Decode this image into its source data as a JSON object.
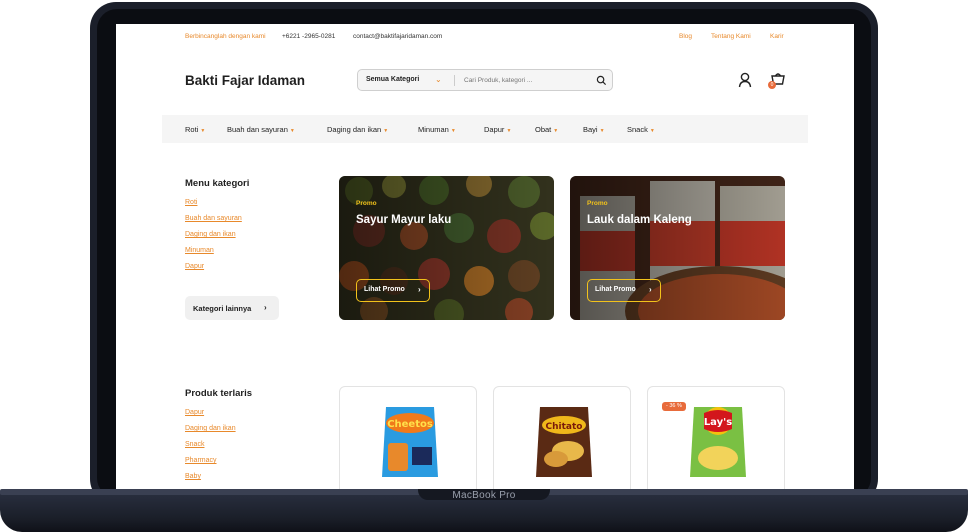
{
  "device": {
    "label": "MacBook Pro"
  },
  "topbar": {
    "chat_label": "Berbincanglah dengan kami",
    "phone": "+6221 -2965-0281",
    "email": "contact@baktifajaridaman.com",
    "links": [
      "Blog",
      "Tentang Kami",
      "Karir"
    ]
  },
  "header": {
    "logo": "Bakti Fajar Idaman",
    "search": {
      "category": "Semua Kategori",
      "placeholder": "Cari Produk, kategori ..."
    },
    "cart_count": "0"
  },
  "nav": {
    "items": [
      "Roti",
      "Buah dan sayuran",
      "Daging dan ikan",
      "Minuman",
      "Dapur",
      "Obat",
      "Bayi",
      "Snack"
    ]
  },
  "menu_kategori": {
    "title": "Menu kategori",
    "links": [
      "Roti",
      "Buah dan sayuran",
      "Daging dan ikan",
      "Minuman",
      "Dapur"
    ],
    "more_button": "Kategori lainnya"
  },
  "promos": [
    {
      "tag": "Promo",
      "title": "Sayur Mayur laku",
      "button": "Lihat Promo"
    },
    {
      "tag": "Promo",
      "title": "Lauk dalam Kaleng",
      "button": "Lihat Promo"
    }
  ],
  "produk_terlaris": {
    "title": "Produk terlaris",
    "links": [
      "Dapur",
      "Daging dan ikan",
      "Snack",
      "Pharmacy",
      "Baby"
    ]
  },
  "products": [
    {
      "name": "Cheetos",
      "icon": "cheetos-pack"
    },
    {
      "name": "Chitato",
      "icon": "chitato-pack"
    },
    {
      "name": "Lay's",
      "icon": "lays-pack",
      "discount": "- 36 %"
    }
  ],
  "colors": {
    "accent": "#e8892b",
    "promo_yellow": "#f2c21b",
    "badge": "#e86b3b"
  }
}
